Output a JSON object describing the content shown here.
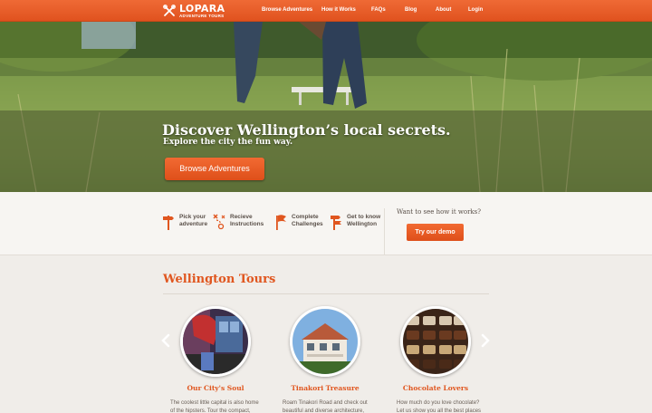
{
  "brand": {
    "name": "LOPARA",
    "tagline": "ADVENTURE TOURS"
  },
  "nav": {
    "items": [
      "Browse Adventures",
      "How it Works",
      "FAQs",
      "Blog",
      "About",
      "Login"
    ]
  },
  "hero": {
    "title": "Discover Wellington’s local secrets.",
    "subtitle": "Explore the city the fun way.",
    "button_label": "Browse Adventures"
  },
  "how_it_works": {
    "steps": [
      {
        "label": "Pick your\nadventure",
        "icon": "signpost-icon"
      },
      {
        "label": "Recieve\nInstructions",
        "icon": "treasure-map-icon"
      },
      {
        "label": "Complete\nChallenges",
        "icon": "flag-icon"
      },
      {
        "label": "Get to know\nWellington",
        "icon": "signpost-icon"
      }
    ],
    "demo_question": "Want to see how it works?",
    "demo_button": "Try our demo"
  },
  "tours": {
    "heading": "Wellington Tours",
    "items": [
      {
        "name": "Our City's Soul",
        "description": "The coolest little capital is also home\nof the hipsters. Tour the compact,"
      },
      {
        "name": "Tinakori Treasure",
        "description": "Roam Tinakori Road and check out\nbeautiful and diverse architecture,"
      },
      {
        "name": "Chocolate Lovers",
        "description": "How much do you love chocolate?\nLet us show you all the best places"
      }
    ]
  },
  "colors": {
    "accent": "#e0561f",
    "nav": "#e95e27",
    "background": "#f0ede9"
  }
}
